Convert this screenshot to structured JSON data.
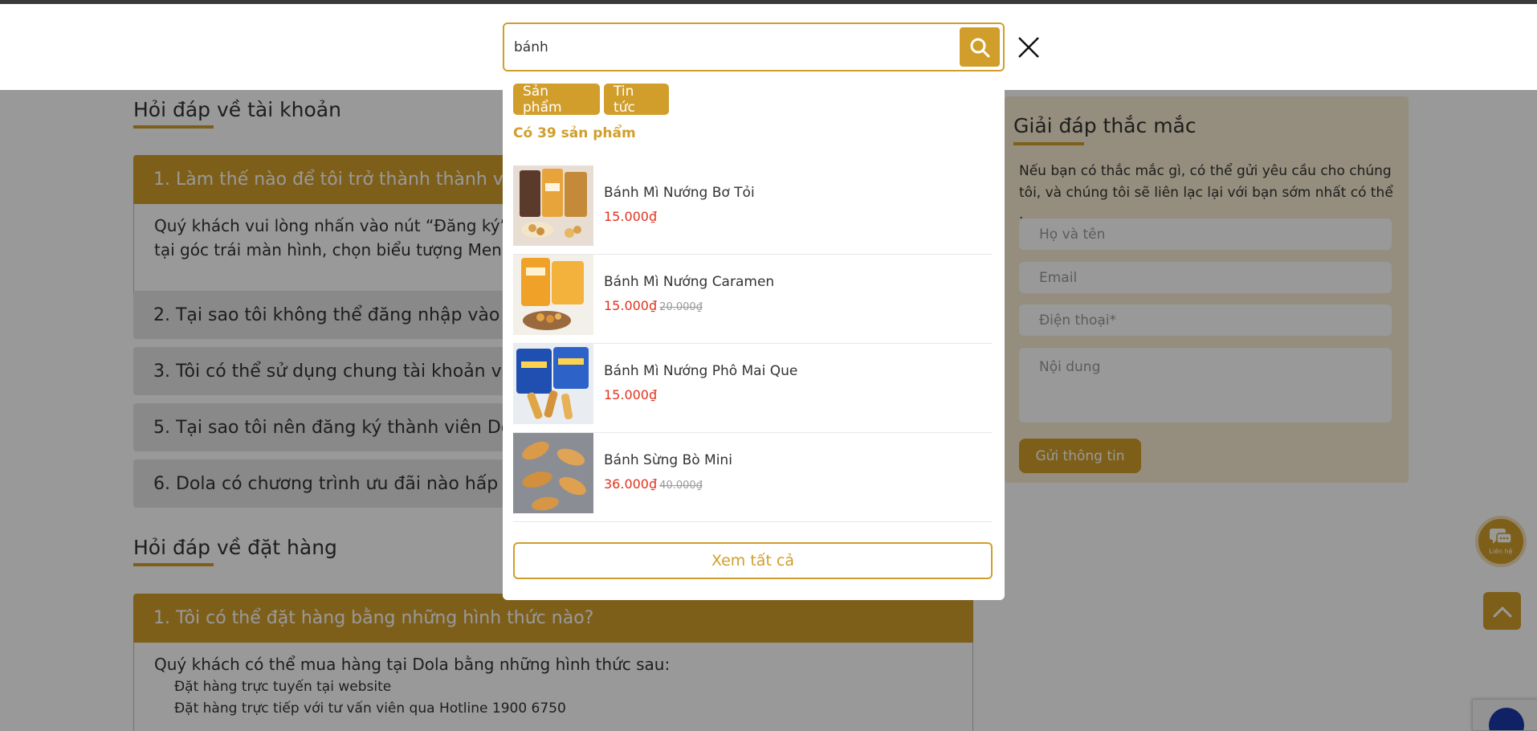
{
  "search": {
    "query": "bánh",
    "tabs": [
      "Sản phẩm",
      "Tin tức"
    ],
    "result_count": "Có 39 sản phẩm",
    "view_all": "Xem tất cả",
    "products": [
      {
        "name": "Bánh Mì Nướng Bơ Tỏi",
        "price": "15.000₫",
        "old_price": ""
      },
      {
        "name": "Bánh Mì Nướng Caramen",
        "price": "15.000₫",
        "old_price": "20.000₫"
      },
      {
        "name": "Bánh Mì Nướng Phô Mai Que",
        "price": "15.000₫",
        "old_price": ""
      },
      {
        "name": "Bánh Sừng Bò Mini",
        "price": "36.000₫",
        "old_price": "40.000₫"
      }
    ]
  },
  "faq": {
    "account_title": "Hỏi đáp về tài khoản",
    "account_items": [
      "1. Làm thế nào để tôi trở thành thành viên",
      "2. Tại sao tôi không thể đăng nhập vào tà",
      "3. Tôi có thể sử dụng chung tài khoản với",
      "5. Tại sao tôi nên đăng ký thành viên Dola",
      "6. Dola có chương trình ưu đãi nào hấp dẫ"
    ],
    "account_answer_1": "Quý khách vui lòng nhấn vào nút “Đăng ký” ở",
    "account_answer_2": "tại góc trái màn hình, chọn biểu tượng Menu rồ",
    "order_title": "Hỏi đáp về đặt hàng",
    "order_item_1": "1. Tôi có thể đặt hàng bằng những hình thức nào?",
    "order_answer_intro": "Quý khách có thể mua hàng tại Dola bằng những hình thức sau:",
    "order_answer_list": [
      "Đặt hàng trực tuyến tại website",
      "Đặt hàng trực tiếp với tư vấn viên qua Hotline 1900 6750"
    ]
  },
  "contact_form": {
    "title": "Giải đáp thắc mắc",
    "description": "Nếu bạn có thắc mắc gì, có thể gửi yêu cầu cho chúng tôi, và chúng tôi sẽ liên lạc lại với bạn sớm nhất có thể .",
    "name_placeholder": "Họ và tên",
    "email_placeholder": "Email",
    "phone_placeholder": "Điện thoại*",
    "content_placeholder": "Nội dung",
    "submit": "Gửi thông tin"
  },
  "chat_label": "Liên hệ",
  "colors": {
    "accent": "#d19e2c",
    "price": "#e0331f",
    "form_bg": "#f9ecd0"
  }
}
